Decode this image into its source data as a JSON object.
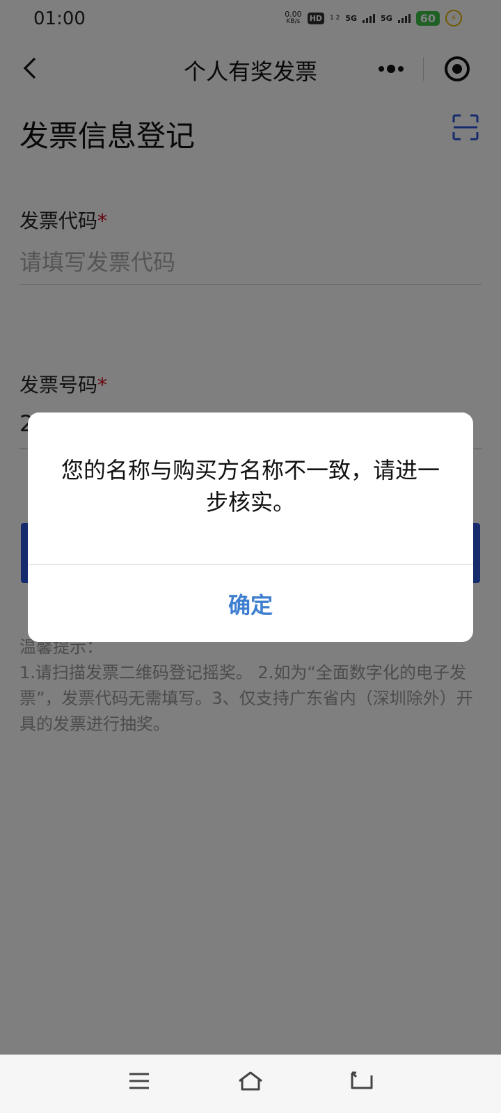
{
  "status_bar": {
    "time": "01:00",
    "speed_value": "0.00",
    "speed_unit": "KB/s",
    "hd": "HD",
    "hd_sub": "1 2",
    "net1": "5G",
    "net2": "5G",
    "battery": "60"
  },
  "nav": {
    "title": "个人有奖发票"
  },
  "page": {
    "title": "发票信息登记"
  },
  "form": {
    "invoice_code": {
      "label": "发票代码",
      "required_mark": "*",
      "placeholder": "请填写发票代码"
    },
    "invoice_number": {
      "label": "发票号码",
      "required_mark": "*",
      "value": "2"
    }
  },
  "tips": {
    "title": "温馨提示：",
    "body": "1.请扫描发票二维码登记摇奖。 2.如为“全面数字化的电子发票”，发票代码无需填写。3、仅支持广东省内（深圳除外）开具的发票进行抽奖。"
  },
  "dialog": {
    "message": "您的名称与购买方名称不一致，请进一步核实。",
    "confirm": "确定"
  },
  "colors": {
    "accent": "#2a56d9",
    "link": "#3d7ecf",
    "required": "#d0021b"
  }
}
